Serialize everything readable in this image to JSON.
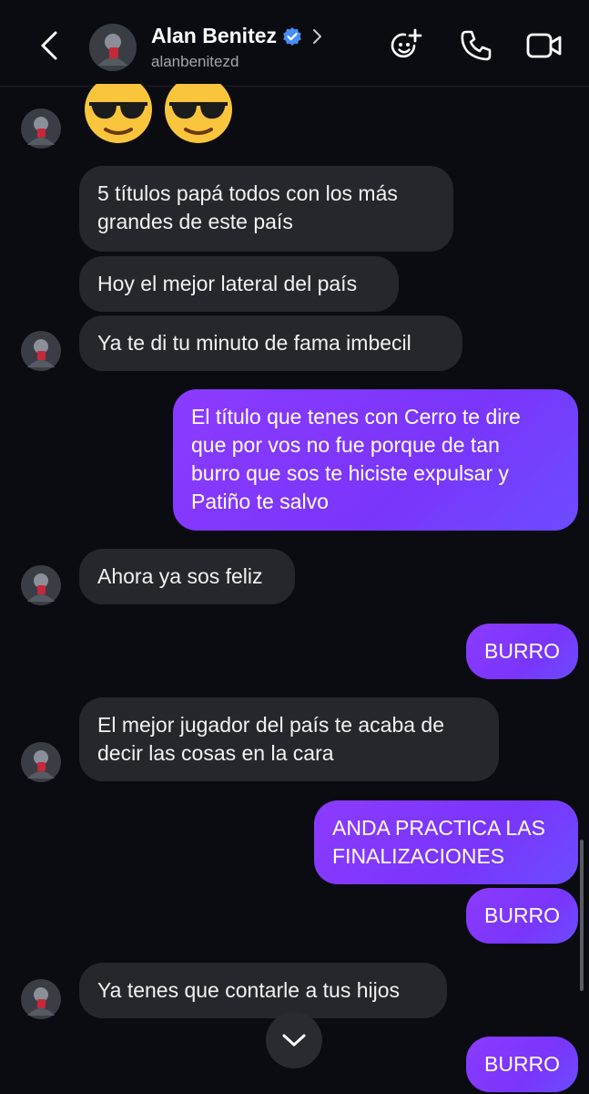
{
  "header": {
    "name": "Alan Benitez",
    "username": "alanbenitezd",
    "icons": [
      "back-icon",
      "verified-icon",
      "chevron-right-icon",
      "add-emoji-icon",
      "phone-icon",
      "video-icon"
    ]
  },
  "messages": [
    {
      "type": "received",
      "text": "5 títulos papá todos con los más\ngrandes de este país"
    },
    {
      "type": "received",
      "text": "Hoy el mejor lateral del país"
    },
    {
      "type": "received",
      "text": "Ya te di tu minuto de fama imbecil"
    },
    {
      "type": "sent",
      "text": "El título que tenes con Cerro te dire\nque por vos no fue porque de tan\nburro que sos te hiciste expulsar y\nPatiño te salvo"
    },
    {
      "type": "received",
      "text": "Ahora ya sos feliz"
    },
    {
      "type": "sent",
      "text": "BURRO"
    },
    {
      "type": "received",
      "text": "El mejor jugador del país te acaba de\ndecir las cosas en la cara"
    },
    {
      "type": "sent",
      "text": "ANDA PRACTICA LAS\nFINALIZACIONES"
    },
    {
      "type": "sent",
      "text": "BURRO"
    },
    {
      "type": "received",
      "text": "Ya tenes que contarle a tus hijos"
    },
    {
      "type": "sent",
      "text": "BURRO"
    }
  ],
  "colors": {
    "background": "#0b0c12",
    "received_bubble": "#26272d",
    "sent_bubble": "#7f38fc",
    "verified": "#4a8ef7"
  }
}
